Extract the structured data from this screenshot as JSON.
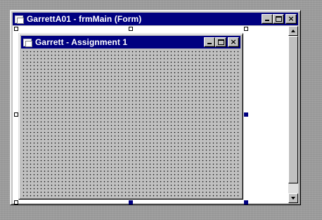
{
  "outer_window": {
    "title": "GarrettA01 - frmMain (Form)",
    "minimize_label": "",
    "maximize_label": "",
    "close_label": "×",
    "icon": "form-icon"
  },
  "form_window": {
    "title": "Garrett - Assignment 1",
    "minimize_label": "",
    "maximize_label": "",
    "close_label": "×",
    "icon": "form-icon"
  },
  "colors": {
    "titlebar": "#000080",
    "face": "#c0c0c0",
    "client": "#ffffff",
    "handle_active": "#000080"
  }
}
